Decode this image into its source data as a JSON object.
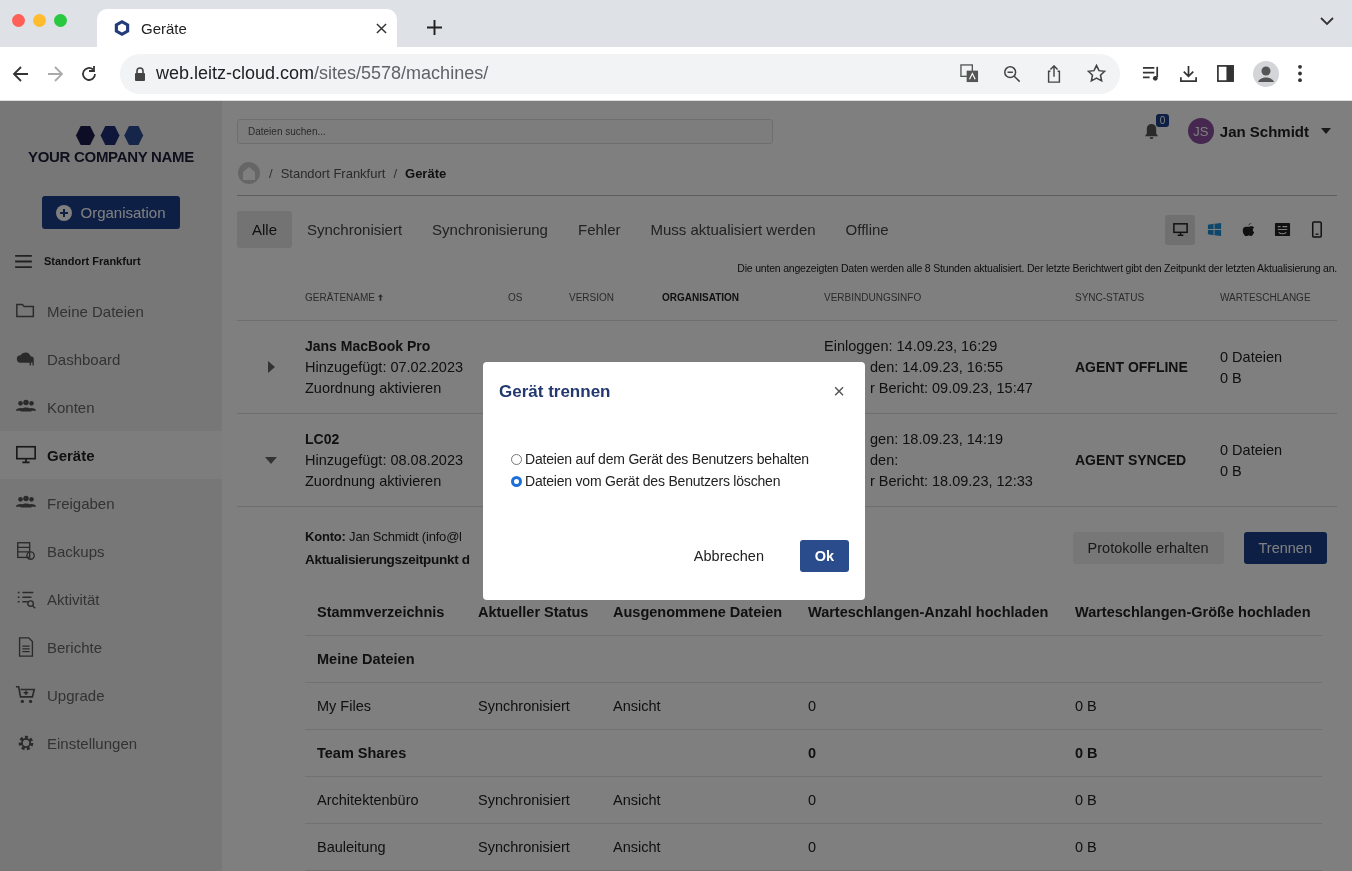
{
  "browser": {
    "tab_title": "Geräte",
    "url_host": "web.leitz-cloud.com",
    "url_path": "/sites/5578/machines/"
  },
  "sidebar": {
    "logo_text": "YOUR COMPANY NAME",
    "org_button": "Organisation",
    "site": "Standort Frankfurt",
    "items": [
      {
        "label": "Meine Dateien",
        "selected": false
      },
      {
        "label": "Dashboard",
        "selected": false
      },
      {
        "label": "Konten",
        "selected": false
      },
      {
        "label": "Geräte",
        "selected": true
      },
      {
        "label": "Freigaben",
        "selected": false
      },
      {
        "label": "Backups",
        "selected": false
      },
      {
        "label": "Aktivität",
        "selected": false
      },
      {
        "label": "Berichte",
        "selected": false
      },
      {
        "label": "Upgrade",
        "selected": false
      },
      {
        "label": "Einstellungen",
        "selected": false
      }
    ]
  },
  "header": {
    "search": {
      "placeholder": "Dateien suchen..."
    },
    "notification_count": "0",
    "user_initials": "JS",
    "user_name": "Jan Schmidt"
  },
  "breadcrumb": [
    {
      "separator": "/",
      "label": "Standort Frankfurt"
    },
    {
      "separator": "/",
      "label": "Geräte"
    }
  ],
  "filter_tabs": [
    {
      "label": "Alle",
      "selected": true
    },
    {
      "label": "Synchronisiert",
      "selected": false
    },
    {
      "label": "Synchronisierung",
      "selected": false
    },
    {
      "label": "Fehler",
      "selected": false
    },
    {
      "label": "Muss aktualisiert werden",
      "selected": false
    },
    {
      "label": "Offline",
      "selected": false
    }
  ],
  "device_types": [
    {
      "selected": true
    },
    {
      "selected": false
    },
    {
      "selected": false
    },
    {
      "selected": false
    },
    {
      "selected": false
    }
  ],
  "notice": "Die unten angezeigten Daten werden alle 8 Stunden aktualisiert. Der letzte Berichtwert gibt den Zeitpunkt der letzten Aktualisierung an.",
  "devices": {
    "columns": [
      {
        "label": "GERÄTENAME",
        "sorted": true,
        "highlighted": false
      },
      {
        "label": "OS",
        "sorted": false,
        "highlighted": false
      },
      {
        "label": "VERSION",
        "sorted": false,
        "highlighted": false
      },
      {
        "label": "ORGANISATION",
        "sorted": false,
        "highlighted": true
      },
      {
        "label": "VERBINDUNGSINFO",
        "sorted": false,
        "highlighted": false
      },
      {
        "label": "SYNC-STATUS",
        "sorted": false,
        "highlighted": false
      },
      {
        "label": "WARTESCHLANGE",
        "sorted": false,
        "highlighted": false
      }
    ],
    "rows": [
      {
        "name": "Jans MacBook Pro",
        "added": "Hinzugefügt: 07.02.2023",
        "link": "Zuordnung aktivieren",
        "expanded": false,
        "connection": [
          {
            "text": "Einloggen: 14.09.23, 16:29"
          },
          {
            "text": "den: 14.09.23, 16:55",
            "covered": true
          },
          {
            "text": "r Bericht: 09.09.23, 15:47",
            "covered": true
          }
        ],
        "sync_status": "AGENT OFFLINE",
        "queue": [
          "0 Dateien",
          "0 B"
        ]
      },
      {
        "name": "LC02",
        "added": "Hinzugefügt: 08.08.2023",
        "link": "Zuordnung aktivieren",
        "expanded": true,
        "connection": [
          {
            "text": "gen: 18.09.23, 14:19",
            "covered": true
          },
          {
            "text": "den:",
            "covered": true
          },
          {
            "text": "r Bericht: 18.09.23, 12:33",
            "covered": true
          }
        ],
        "sync_status": "AGENT SYNCED",
        "queue": [
          "0 Dateien",
          "0 B"
        ],
        "details": {
          "account_label": "Konto:",
          "account_value": "Jan Schmidt (info@l",
          "update_label": "Aktualisierungszeitpunkt d",
          "buttons": [
            {
              "label": "Protokolle erhalten",
              "kind": "secondary"
            },
            {
              "label": "Trennen",
              "kind": "primary"
            }
          ],
          "folders": {
            "columns": [
              "Stammverzeichnis",
              "Aktueller Status",
              "Ausgenommene Dateien",
              "Warteschlangen-Anzahl hochladen",
              "Warteschlangen-Größe hochladen"
            ],
            "rows": [
              {
                "kind": "group",
                "name": "Meine Dateien"
              },
              {
                "kind": "item",
                "name": "My Files",
                "status": "Synchronisiert",
                "excluded": "Ansicht",
                "queue_count": "0",
                "queue_size": "0 B"
              },
              {
                "kind": "group",
                "name": "Team Shares",
                "queue_count": "0",
                "queue_size": "0 B"
              },
              {
                "kind": "item",
                "name": "Architektenbüro",
                "status": "Synchronisiert",
                "excluded": "Ansicht",
                "queue_count": "0",
                "queue_size": "0 B"
              },
              {
                "kind": "item",
                "name": "Bauleitung",
                "status": "Synchronisiert",
                "excluded": "Ansicht",
                "queue_count": "0",
                "queue_size": "0 B"
              }
            ]
          }
        }
      }
    ]
  },
  "modal": {
    "title": "Gerät trennen",
    "close": "×",
    "options": [
      {
        "label": "Dateien auf dem Gerät des Benutzers behalten",
        "selected": false
      },
      {
        "label": "Dateien vom Gerät des Benutzers löschen",
        "selected": true
      }
    ],
    "cancel": "Abbrechen",
    "ok": "Ok"
  }
}
